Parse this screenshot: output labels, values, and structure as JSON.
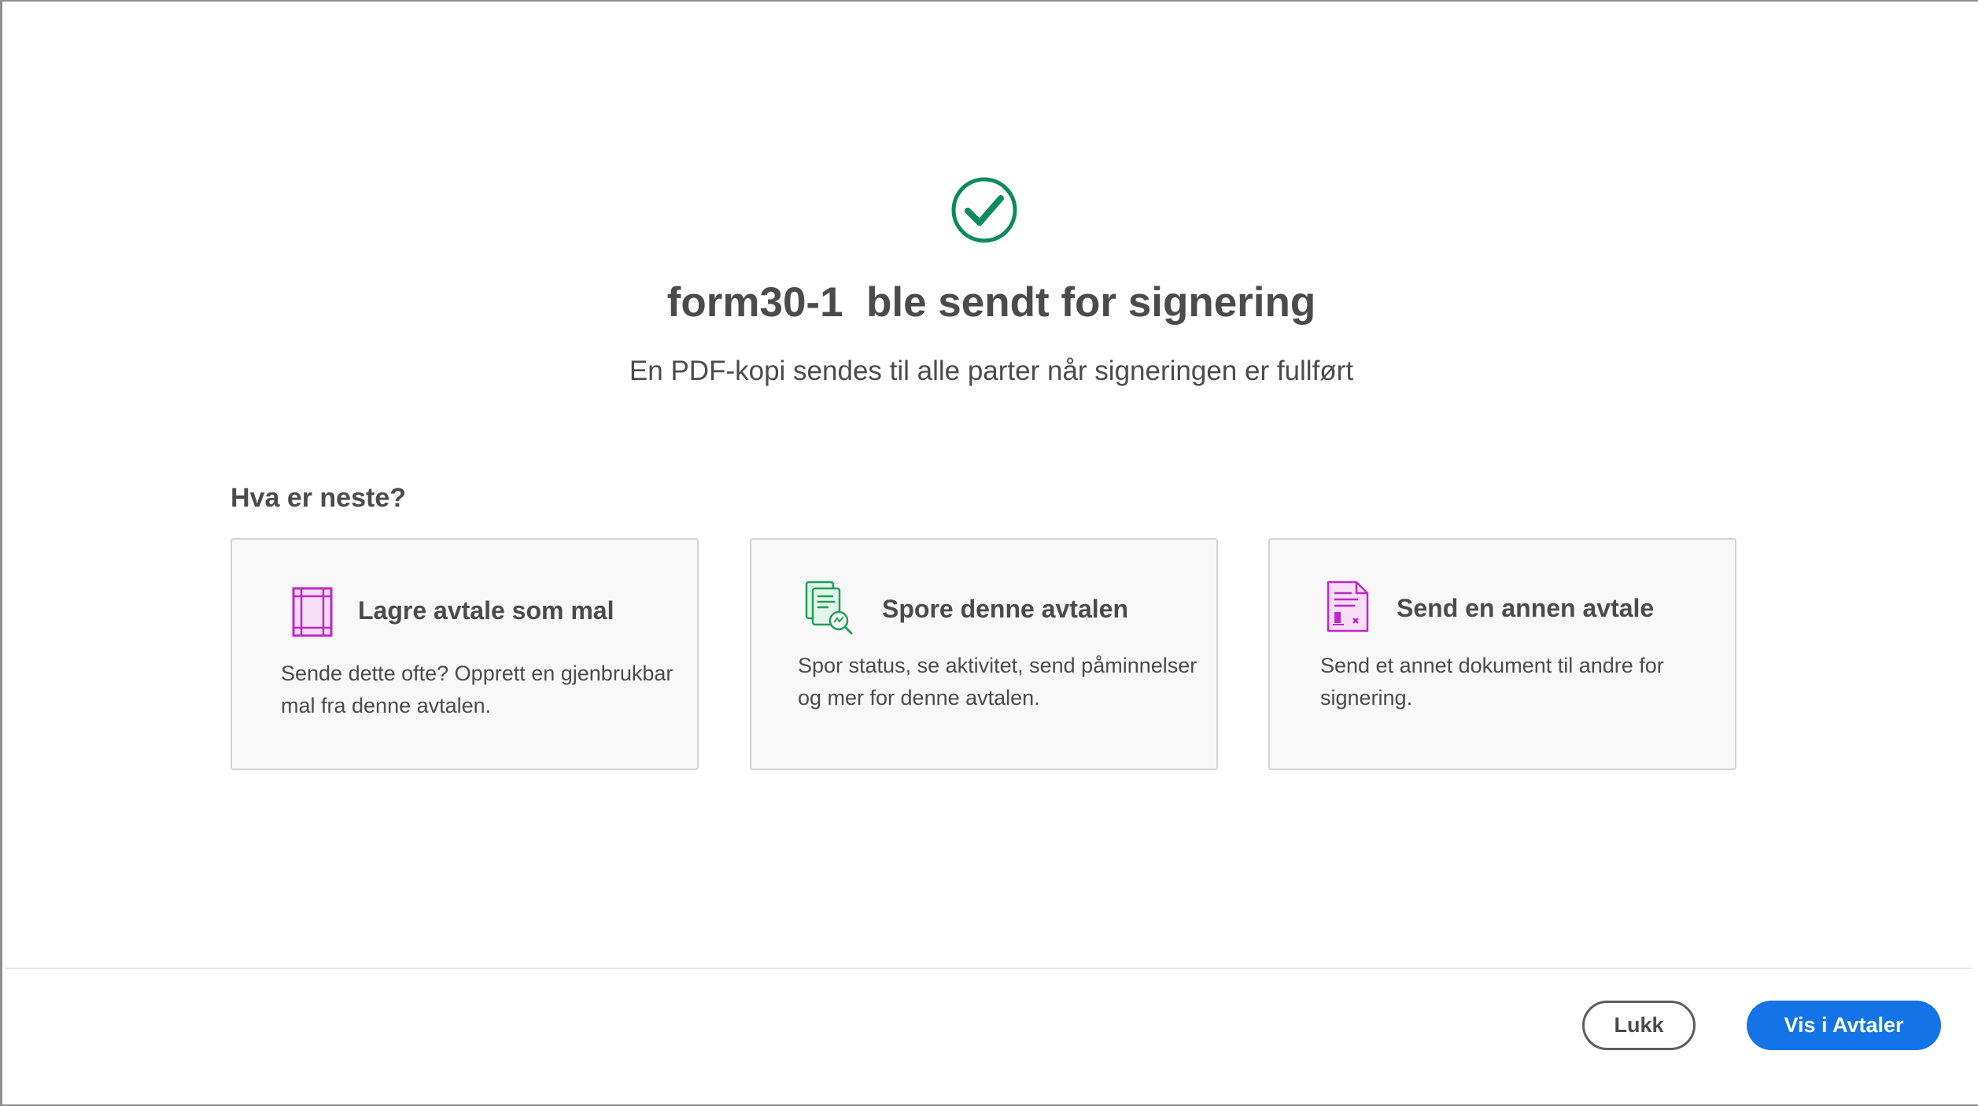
{
  "dialog": {
    "title": "form30-1  ble sendt for signering",
    "subtitle": "En PDF-kopi sendes til alle parter når signeringen er fullført",
    "success_icon": "check-circle-icon",
    "success_color": "#0b8a5a"
  },
  "next_steps": {
    "heading": "Hva er neste?",
    "cards": [
      {
        "icon": "template-icon",
        "icon_color": "#c026c9",
        "title": "Lagre avtale som mal",
        "description": "Sende dette ofte? Opprett en gjenbrukbar mal fra denne avtalen."
      },
      {
        "icon": "track-document-icon",
        "icon_color": "#1f9e5b",
        "title": "Spore denne avtalen",
        "description": "Spor status, se aktivitet, send påminnelser og mer for denne avtalen."
      },
      {
        "icon": "sign-document-icon",
        "icon_color": "#c026c9",
        "title": "Send en annen avtale",
        "description": "Send et annet dokument til andre for signering."
      }
    ]
  },
  "footer": {
    "close_label": "Lukk",
    "primary_label": "Vis i Avtaler",
    "primary_color": "#1473e6"
  }
}
